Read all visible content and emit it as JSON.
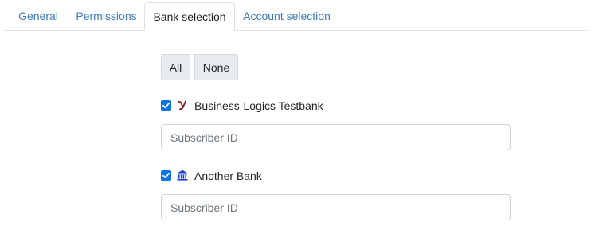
{
  "tabs": [
    {
      "label": "General"
    },
    {
      "label": "Permissions"
    },
    {
      "label": "Bank selection"
    },
    {
      "label": "Account selection"
    }
  ],
  "buttons": {
    "all": "All",
    "none": "None"
  },
  "banks": [
    {
      "name": "Business-Logics Testbank",
      "checked": true,
      "icon": "y-logo-icon",
      "subscriber_placeholder": "Subscriber ID",
      "subscriber_value": ""
    },
    {
      "name": "Another Bank",
      "checked": true,
      "icon": "bank-building-icon",
      "subscriber_placeholder": "Subscriber ID",
      "subscriber_value": ""
    }
  ],
  "colors": {
    "accent": "#0b74e5",
    "link": "#3a7bb8",
    "border": "#dee2e6",
    "button_bg": "#e9ecef"
  }
}
